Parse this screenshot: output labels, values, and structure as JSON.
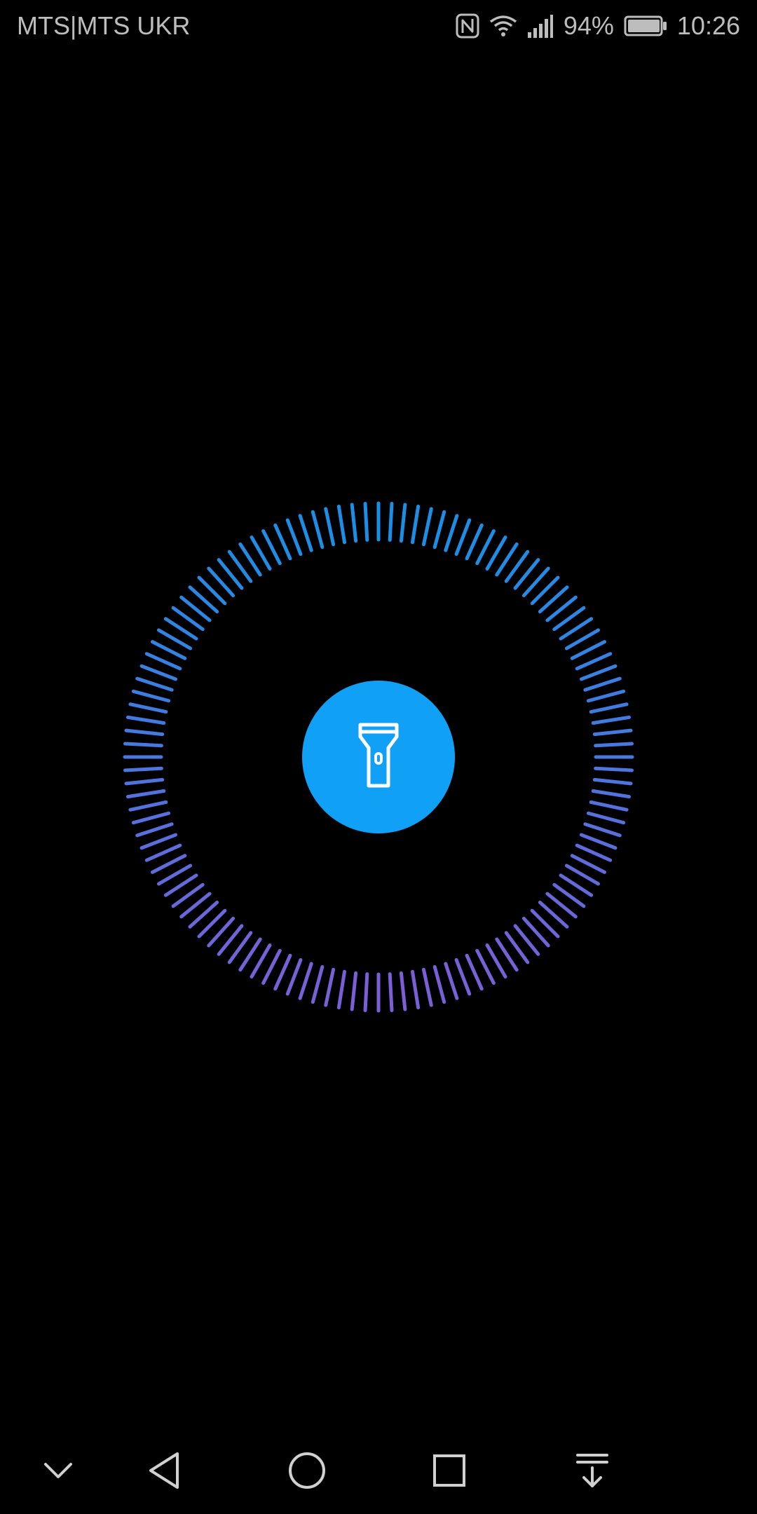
{
  "status_bar": {
    "carrier": "MTS|MTS UKR",
    "battery_percent": "94%",
    "time": "10:26",
    "icons": [
      "nfc-icon",
      "wifi-icon",
      "signal-icon",
      "battery-icon"
    ],
    "text_color": "#bdbdbd"
  },
  "flashlight": {
    "button_icon": "flashlight-icon",
    "button_color": "#10a0f6",
    "ring_color_top": "#1a8fe6",
    "ring_color_bottom": "#7a5fd6",
    "ring_tick_count": 120
  },
  "nav_bar": {
    "items": [
      {
        "icon": "chevron-down-icon"
      },
      {
        "icon": "back-icon"
      },
      {
        "icon": "home-icon"
      },
      {
        "icon": "recents-icon"
      },
      {
        "icon": "notification-pull-icon"
      }
    ],
    "icon_color": "#d0d0d0"
  }
}
